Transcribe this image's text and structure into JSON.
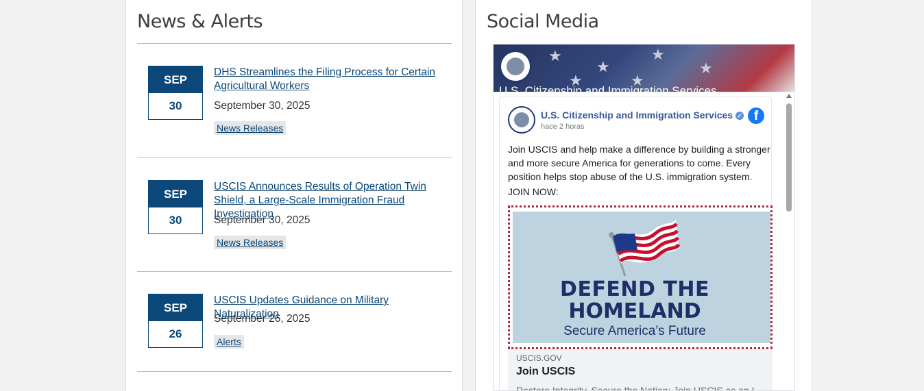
{
  "news": {
    "heading": "News & Alerts",
    "items": [
      {
        "month": "SEP",
        "day": "30",
        "title": "DHS Streamlines the Filing Process for Certain Agricultural Workers",
        "date": "September 30, 2025",
        "tag": "News Releases"
      },
      {
        "month": "SEP",
        "day": "30",
        "title": "USCIS Announces Results of Operation Twin Shield, a Large-Scale Immigration Fraud Investigation",
        "date": "September 30, 2025",
        "tag": "News Releases"
      },
      {
        "month": "SEP",
        "day": "26",
        "title": "USCIS Updates Guidance on Military Naturalization",
        "date": "September 26, 2025",
        "tag": "Alerts"
      }
    ]
  },
  "social": {
    "heading": "Social Media",
    "cover_title": "U.S. Citizenship and Immigration Services",
    "post": {
      "page_name": "U.S. Citizenship and Immigration Services",
      "time": "hace 2 horas",
      "text": "Join USCIS and help make a difference by building a stronger and more secure America for generations to come. Every position helps stop abuse of the U.S. immigration system.",
      "join": "JOIN NOW:",
      "image": {
        "line1": "DEFEND THE",
        "line2": "HOMELAND",
        "line3": "Secure America’s Future"
      },
      "link": {
        "domain": "USCIS.GOV",
        "title": "Join USCIS",
        "description": "Restore Integrity, Secure the Nation: Join USCIS as an I..."
      }
    }
  },
  "colors": {
    "brand_blue": "#0b4778",
    "facebook_blue": "#1877f2",
    "link_blue": "#385898"
  }
}
